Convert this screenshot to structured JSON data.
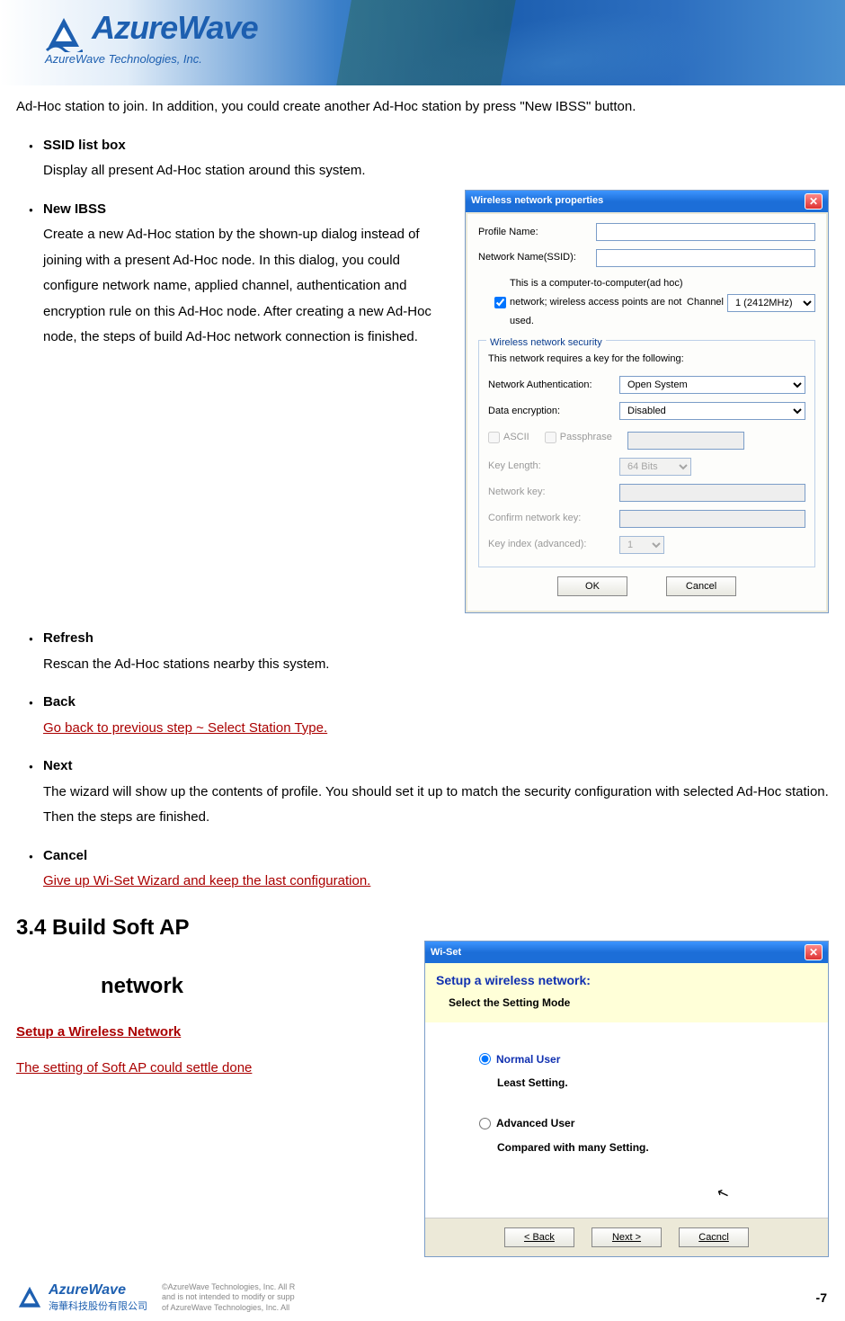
{
  "header": {
    "logo_main": "AzureWave",
    "logo_sub": "AzureWave  Technologies,  Inc."
  },
  "intro": "Ad-Hoc station to join. In addition, you could create another Ad-Hoc station by press \"New IBSS\" button.",
  "items": [
    {
      "title": "SSID list box",
      "desc": "Display all present Ad-Hoc station around this system."
    },
    {
      "title": "New IBSS",
      "desc": "Create a new Ad-Hoc station by the shown-up dialog instead of joining with a present Ad-Hoc node. In this dialog, you could configure network name, applied channel, authentication and encryption rule on this Ad-Hoc node. After creating a new Ad-Hoc node, the steps of build Ad-Hoc network connection is finished."
    },
    {
      "title": "Refresh",
      "desc": "Rescan the Ad-Hoc stations nearby this system."
    },
    {
      "title": "Back",
      "desc": "Go back to previous step ~ Select Station Type.",
      "link": true
    },
    {
      "title": "Next",
      "desc": "The wizard will show up the contents of profile. You should set it up to match the security configuration with selected Ad-Hoc station. Then the steps are finished."
    },
    {
      "title": "Cancel",
      "desc": "Give up Wi-Set Wizard and keep the last configuration.",
      "link": true
    }
  ],
  "dialog1": {
    "title": "Wireless network properties",
    "profile_label": "Profile Name:",
    "ssid_label": "Network Name(SSID):",
    "adhoc_check": "This is a computer-to-computer(ad hoc) network; wireless access points are not used.",
    "channel_label": "Channel",
    "channel_value": "1 (2412MHz)",
    "group_title": "Wireless network security",
    "group_note": "This network requires a key for the following:",
    "auth_label": "Network Authentication:",
    "auth_value": "Open System",
    "enc_label": "Data encryption:",
    "enc_value": "Disabled",
    "ascii": "ASCII",
    "passphrase": "Passphrase",
    "keylen_label": "Key Length:",
    "keylen_value": "64 Bits",
    "netkey_label": "Network key:",
    "confkey_label": "Confirm network key:",
    "keyidx_label": "Key index (advanced):",
    "keyidx_value": "1",
    "ok": "OK",
    "cancel": "Cancel"
  },
  "section34": {
    "num": "3.4",
    "title": "Build Soft AP",
    "sub": "network",
    "heading": "Setup a Wireless Network",
    "text": "The setting of Soft AP could settle done"
  },
  "dialog2": {
    "window": "Wi-Set",
    "h1": "Setup a wireless network:",
    "h2": "Select the Setting Mode",
    "opt1": "Normal User",
    "opt1_desc": "Least Setting.",
    "opt2": "Advanced User",
    "opt2_desc": "Compared with many Setting.",
    "back": "< Back",
    "next": "Next >",
    "cancel": "Cacncl"
  },
  "footer": {
    "logo": "AzureWave",
    "cn": "海華科技股份有限公司",
    "legal1": "©AzureWave Technologies, Inc. All R",
    "legal2": "and is not intended to modify or supp",
    "legal3": "of AzureWave Technologies, Inc.  All",
    "page": "-7"
  }
}
